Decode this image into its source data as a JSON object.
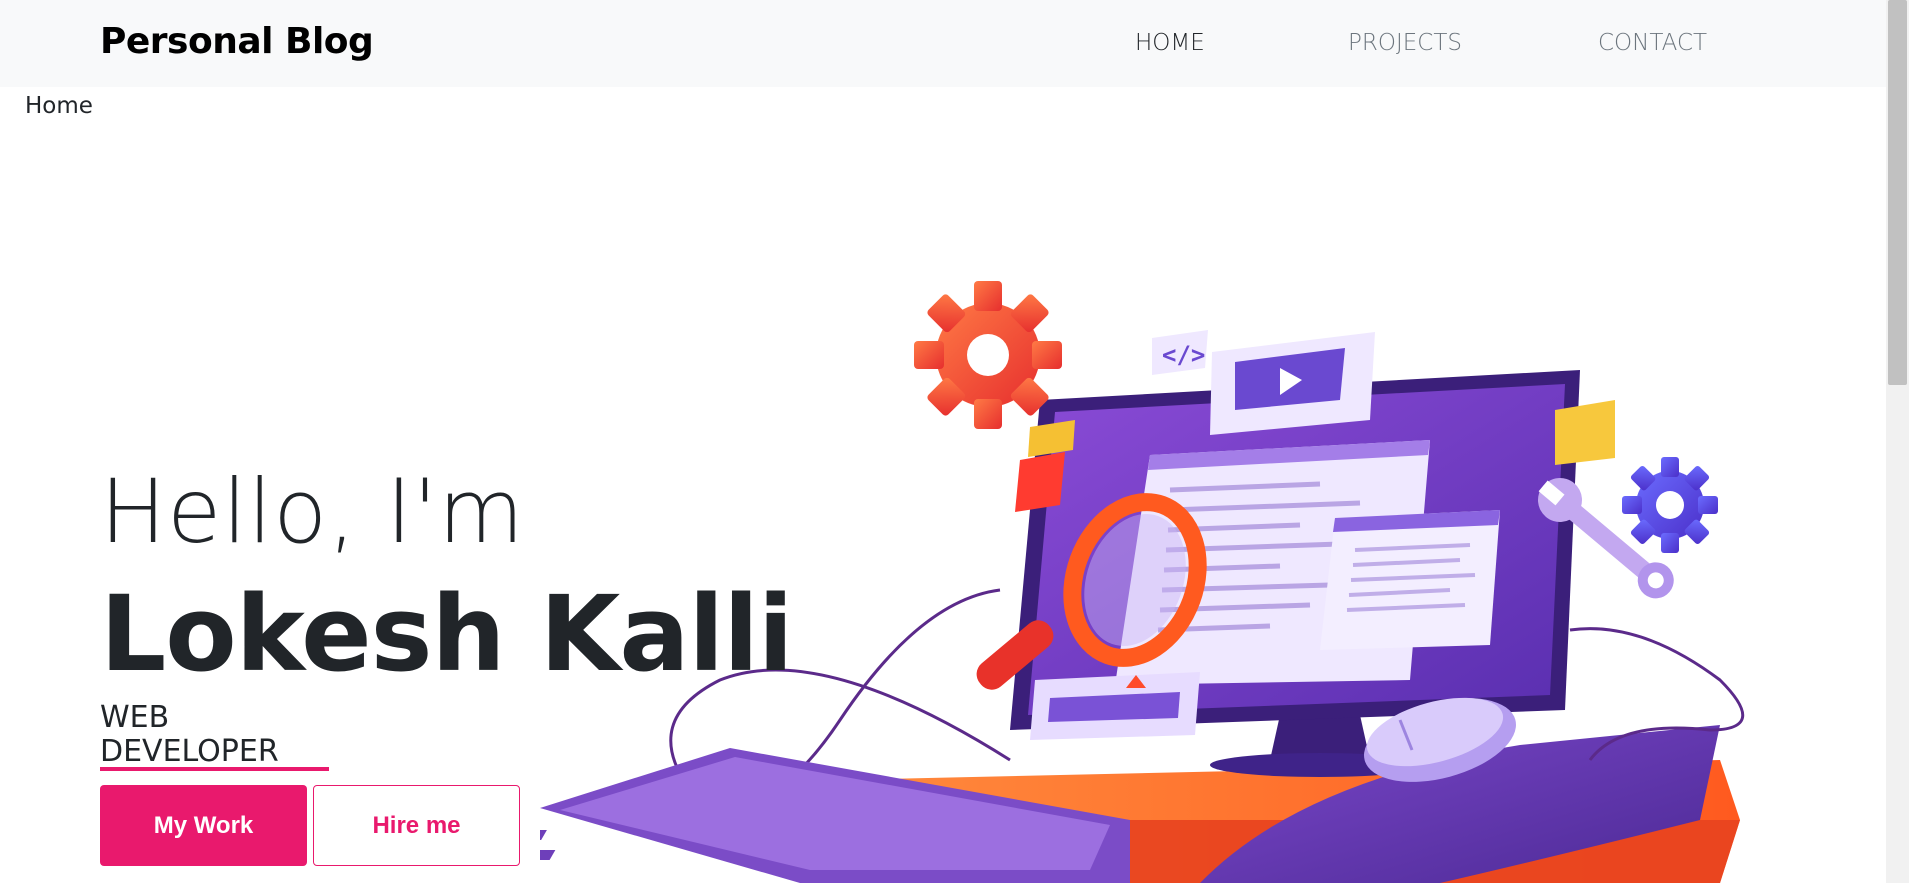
{
  "navbar": {
    "brand": "Personal Blog",
    "links": [
      {
        "label": "HOME",
        "active": true
      },
      {
        "label": "PROJECTS",
        "active": false
      },
      {
        "label": "CONTACT",
        "active": false
      }
    ]
  },
  "breadcrumb": "Home",
  "hero": {
    "greeting": "Hello, I'm",
    "name": "Lokesh Kalli",
    "role_line1": "WEB",
    "role_line2": "DEVELOPER",
    "primary_button": "My Work",
    "secondary_button": "Hire me"
  },
  "colors": {
    "accent": "#e9196d",
    "nav_bg": "#f8f9fa",
    "text": "#212529",
    "muted": "#6c757d"
  },
  "icons": [
    "gear-icon",
    "code-icon",
    "play-icon",
    "magnifier-icon",
    "wrench-icon",
    "monitor-icon",
    "keyboard-icon",
    "mouse-icon"
  ]
}
